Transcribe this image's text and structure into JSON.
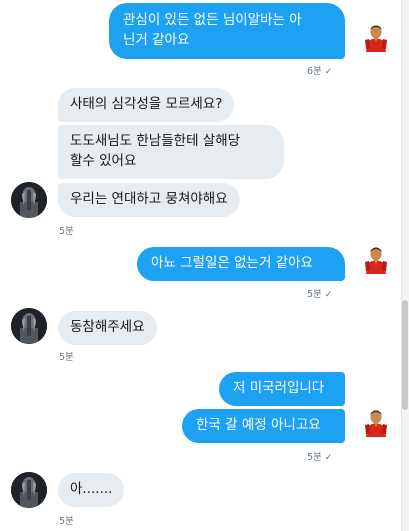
{
  "messages": [
    {
      "text": "관심이 있든 없든 님이알바는 아\n닌거 같아요"
    },
    {
      "text": "사태의 심각성을 모르세요?"
    },
    {
      "text": "도도새님도 한남들한테 살해당\n할수 있어요"
    },
    {
      "text": "우리는 연대하고 뭉쳐야해요"
    },
    {
      "text": "아뇨 그럴일은 없는거 같아요"
    },
    {
      "text": "동참해주세요"
    },
    {
      "text": "저 미국러입니다"
    },
    {
      "text": "한국 갈 예정 아니고요"
    },
    {
      "text": "아......."
    }
  ],
  "times": {
    "t1": "6분",
    "t2": "5분",
    "t3": "5분",
    "t4": "5분",
    "t5": "5분",
    "t6": "5분"
  },
  "icons": {
    "check": "✓"
  },
  "colors": {
    "outgoing": "#1da1f2",
    "incoming": "#e6ecf0",
    "timestamp": "#657786"
  }
}
